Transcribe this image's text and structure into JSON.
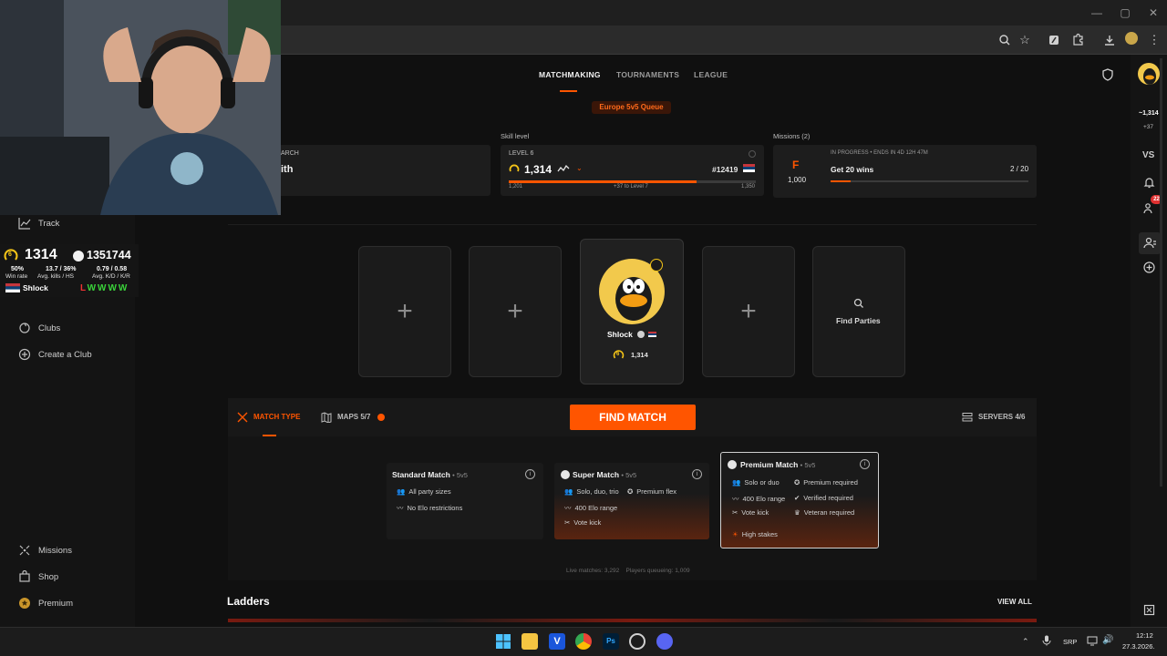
{
  "nav": {
    "tabs": [
      "MATCHMAKING",
      "TOURNAMENTS",
      "LEAGUE"
    ],
    "active": "MATCHMAKING"
  },
  "queue_label": "Europe 5v5 Queue",
  "search_card": {
    "label": "ARCH",
    "value": "ith"
  },
  "skill": {
    "section_label": "Skill level",
    "level_label": "LEVEL 6",
    "elo": "1,314",
    "rank": "#12419",
    "bar_min": "1,201",
    "bar_mid": "+37 to Level 7",
    "bar_max": "1,350",
    "progress": 0.76
  },
  "missions_card": {
    "section_label": "Missions (2)",
    "badge_letter": "F",
    "points": "1,000",
    "status": "IN PROGRESS • ENDS IN 4D 12H 47M",
    "title": "Get 20 wins",
    "progress_text": "2 / 20",
    "progress": 0.1
  },
  "sidebar": {
    "track": "Track",
    "clubs": "Clubs",
    "create_club": "Create a Club",
    "missions": "Missions",
    "shop": "Shop",
    "premium": "Premium"
  },
  "stats_overlay": {
    "level": "6",
    "elo": "1314",
    "points": "1351744",
    "win_rate_val": "50%",
    "win_rate_lbl": "Win rate",
    "kills_val": "13.7 / 36%",
    "kills_lbl": "Avg. kills / HS",
    "kd_val": "0.79 / 0.58",
    "kd_lbl": "Avg. K/D / K/R",
    "name": "Shlock",
    "results": [
      "L",
      "W",
      "W",
      "W",
      "W"
    ]
  },
  "player": {
    "name": "Shlock",
    "level": "6",
    "elo": "1,314"
  },
  "find_parties": "Find Parties",
  "controls": {
    "match_type": "MATCH TYPE",
    "maps": "MAPS 5/7",
    "find_match": "FIND MATCH",
    "servers": "SERVERS 4/6"
  },
  "modes": [
    {
      "title": "Standard Match",
      "sub": "• 5v5",
      "features": [
        "All party sizes",
        "No Elo restrictions"
      ]
    },
    {
      "title": "Super Match",
      "sub": "• 5v5",
      "features": [
        "Solo, duo, trio",
        "Premium flex",
        "400 Elo range",
        "Vote kick"
      ]
    },
    {
      "title": "Premium Match",
      "sub": "• 5v5",
      "features": [
        "Solo or duo",
        "Premium required",
        "400 Elo range",
        "Verified required",
        "Vote kick",
        "Veteran required",
        "High stakes"
      ]
    }
  ],
  "live": {
    "matches_lbl": "Live matches:",
    "matches": "3,292",
    "queue_lbl": "Players queueing:",
    "queue": "1,009"
  },
  "ladders": {
    "title": "Ladders",
    "view_all": "VIEW ALL"
  },
  "rail": {
    "elo": "~1,314",
    "delta": "+37",
    "vs": "VS",
    "notif_count": "22"
  },
  "taskbar": {
    "lang": "SRP",
    "time": "12:12",
    "date": "27.3.2026."
  },
  "colors": {
    "accent": "#ff5500",
    "accent_dark": "#c2410c",
    "level_yellow": "#f5c518",
    "win": "#3ad33a",
    "loss": "#e33"
  }
}
